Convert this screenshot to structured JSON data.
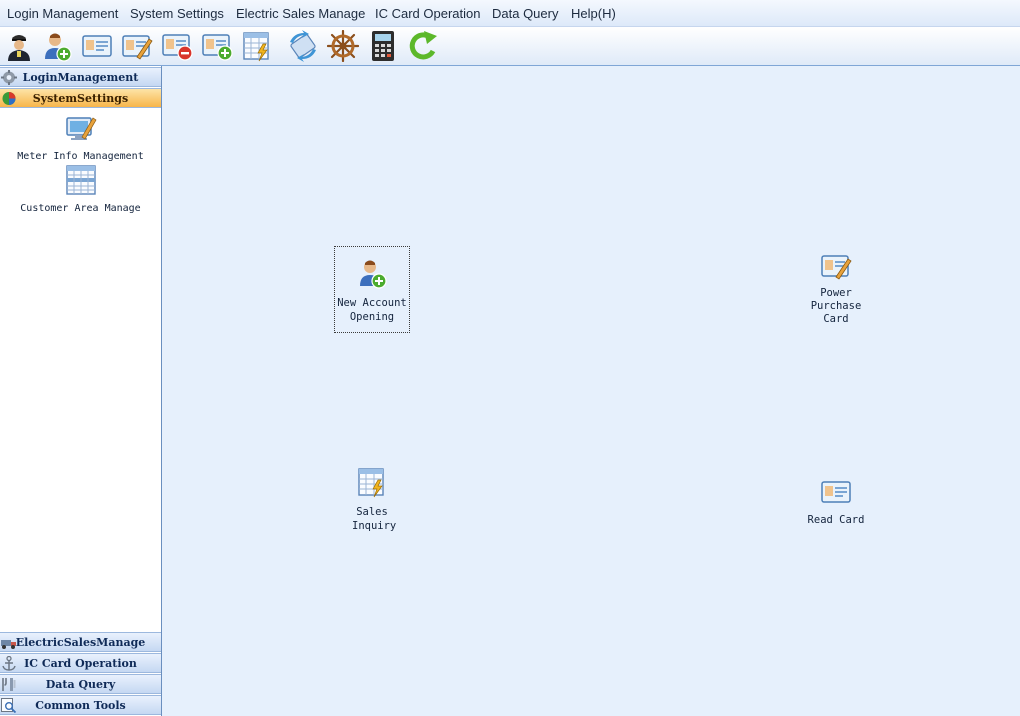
{
  "menubar": {
    "items": [
      "Login Management",
      "System Settings",
      "Electric Sales Manage",
      "IC Card Operation",
      "Data Query",
      "Help(H)"
    ]
  },
  "toolbar": {
    "icons": [
      "officer-icon",
      "add-user-icon",
      "card-icon",
      "card-edit-icon",
      "card-remove-icon",
      "card-add-icon",
      "spreadsheet-power-icon",
      "card-swap-icon",
      "ship-wheel-icon",
      "calculator-icon",
      "refresh-icon"
    ]
  },
  "sidebar": {
    "sections": [
      {
        "label": "LoginManagement",
        "icon": "gear-icon"
      },
      {
        "label": "SystemSettings",
        "icon": "pie-chart-icon",
        "active": true
      },
      {
        "label": "ElectricSalesManage",
        "icon": "truck-icon"
      },
      {
        "label": "IC Card Operation",
        "icon": "anchor-icon"
      },
      {
        "label": "Data Query",
        "icon": "tools-icon"
      },
      {
        "label": "Common Tools",
        "icon": "magnifier-icon"
      }
    ],
    "tools": [
      {
        "label": "Meter Info Management",
        "icon": "monitor-edit-icon"
      },
      {
        "label": "Customer Area Manage",
        "icon": "grid-table-icon"
      }
    ]
  },
  "main": {
    "tiles": [
      {
        "label": "New Account Opening",
        "icon": "add-user-icon"
      },
      {
        "label": "Power Purchase Card",
        "icon": "card-edit-icon"
      },
      {
        "label": "Sales Inquiry",
        "icon": "spreadsheet-power-icon"
      },
      {
        "label": "Read Card",
        "icon": "card-icon"
      }
    ]
  }
}
